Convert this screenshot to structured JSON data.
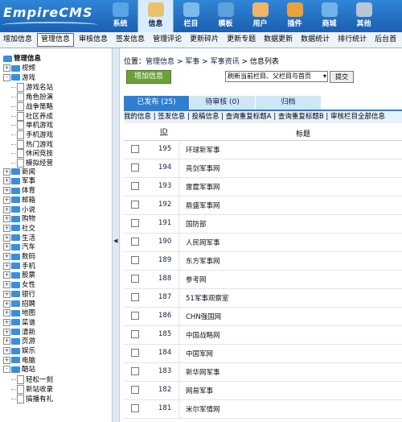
{
  "app": {
    "logo": "EmpireCMS"
  },
  "topnav": [
    {
      "label": "系统",
      "icon": "globe-icon",
      "color": "#57a4e6"
    },
    {
      "label": "信息",
      "icon": "document-edit-icon",
      "color": "#e8c36b",
      "active": true
    },
    {
      "label": "栏目",
      "icon": "folder-icon",
      "color": "#7fb9ec"
    },
    {
      "label": "模板",
      "icon": "template-icon",
      "color": "#5fa0dc"
    },
    {
      "label": "用户",
      "icon": "users-icon",
      "color": "#f0b46a"
    },
    {
      "label": "插件",
      "icon": "tools-icon",
      "color": "#e9a23b"
    },
    {
      "label": "商城",
      "icon": "shop-icon",
      "color": "#6fb3e8"
    },
    {
      "label": "其他",
      "icon": "gear-icon",
      "color": "#b9c6d3"
    }
  ],
  "subbar": [
    "增加信息",
    "管理信息",
    "审核信息",
    "签发信息",
    "管理评论",
    "更新碎片",
    "更新专题",
    "数据更新",
    "数据统计",
    "排行统计",
    "后台首"
  ],
  "subbar_active_index": 1,
  "tree": {
    "root": "管理信息",
    "items": [
      {
        "label": "视频",
        "type": "folder",
        "sign": "+"
      },
      {
        "label": "游戏",
        "type": "folder",
        "sign": "-"
      },
      {
        "label": "游戏名站",
        "type": "doc",
        "indent": true
      },
      {
        "label": "角色扮演",
        "type": "doc",
        "indent": true
      },
      {
        "label": "战争策略",
        "type": "doc",
        "indent": true
      },
      {
        "label": "社区养成",
        "type": "doc",
        "indent": true
      },
      {
        "label": "单机游戏",
        "type": "doc",
        "indent": true
      },
      {
        "label": "手机游戏",
        "type": "doc",
        "indent": true
      },
      {
        "label": "热门游戏",
        "type": "doc",
        "indent": true
      },
      {
        "label": "休闲竞技",
        "type": "doc",
        "indent": true
      },
      {
        "label": "模拟经营",
        "type": "doc",
        "indent": true
      },
      {
        "label": "新闻",
        "type": "folder",
        "sign": "+"
      },
      {
        "label": "军事",
        "type": "folder",
        "sign": "+"
      },
      {
        "label": "体育",
        "type": "folder",
        "sign": "+"
      },
      {
        "label": "邮箱",
        "type": "folder",
        "sign": "+"
      },
      {
        "label": "小说",
        "type": "folder",
        "sign": "+"
      },
      {
        "label": "购物",
        "type": "folder",
        "sign": "+"
      },
      {
        "label": "社交",
        "type": "folder",
        "sign": "+"
      },
      {
        "label": "生活",
        "type": "folder",
        "sign": "+"
      },
      {
        "label": "汽车",
        "type": "folder",
        "sign": "+"
      },
      {
        "label": "数码",
        "type": "folder",
        "sign": "+"
      },
      {
        "label": "手机",
        "type": "folder",
        "sign": "+"
      },
      {
        "label": "股票",
        "type": "folder",
        "sign": "+"
      },
      {
        "label": "女性",
        "type": "folder",
        "sign": "+"
      },
      {
        "label": "银行",
        "type": "folder",
        "sign": "+"
      },
      {
        "label": "招聘",
        "type": "folder",
        "sign": "+"
      },
      {
        "label": "地图",
        "type": "folder",
        "sign": "+"
      },
      {
        "label": "菜谱",
        "type": "folder",
        "sign": "+"
      },
      {
        "label": "清新",
        "type": "folder",
        "sign": "+"
      },
      {
        "label": "页游",
        "type": "folder",
        "sign": "+"
      },
      {
        "label": "娱乐",
        "type": "folder",
        "sign": "+"
      },
      {
        "label": "电脑",
        "type": "folder",
        "sign": "+"
      },
      {
        "label": "酷站",
        "type": "folder",
        "sign": "-"
      },
      {
        "label": "轻松一刻",
        "type": "doc",
        "indent": true
      },
      {
        "label": "新站收录",
        "type": "doc",
        "indent": true
      },
      {
        "label": "搞播有礼",
        "type": "doc",
        "indent": true
      }
    ]
  },
  "location": {
    "prefix": "位置：",
    "crumbs": [
      "管理信息",
      "军事",
      "军事资讯",
      "信息列表"
    ]
  },
  "toolbar": {
    "add_label": "增加信息",
    "select_value": "刷新当前栏目、父栏目与首页",
    "submit_label": "提交"
  },
  "tabs": [
    "已发布 (25)",
    "待审核 (0)",
    "归档"
  ],
  "filters": "我的信息 | 签发信息 | 投稿信息 | 查询重复标题A | 查询重复标题B | 审核栏目全部信息",
  "table": {
    "header_id": "ID",
    "header_title": "标题",
    "rows": [
      {
        "id": "195",
        "title": "环球新军事"
      },
      {
        "id": "194",
        "title": "亮剑军事网"
      },
      {
        "id": "193",
        "title": "雷霆军事网"
      },
      {
        "id": "192",
        "title": "鼎盛军事网"
      },
      {
        "id": "191",
        "title": "国防部"
      },
      {
        "id": "190",
        "title": "人民网军事"
      },
      {
        "id": "189",
        "title": "东方军事网"
      },
      {
        "id": "188",
        "title": "参考网"
      },
      {
        "id": "187",
        "title": "51军事观察室"
      },
      {
        "id": "186",
        "title": "CHN强国网"
      },
      {
        "id": "185",
        "title": "中国战略网"
      },
      {
        "id": "184",
        "title": "中国军网"
      },
      {
        "id": "183",
        "title": "新华网军事"
      },
      {
        "id": "182",
        "title": "网易军事"
      },
      {
        "id": "181",
        "title": "米尔军情网"
      }
    ]
  }
}
